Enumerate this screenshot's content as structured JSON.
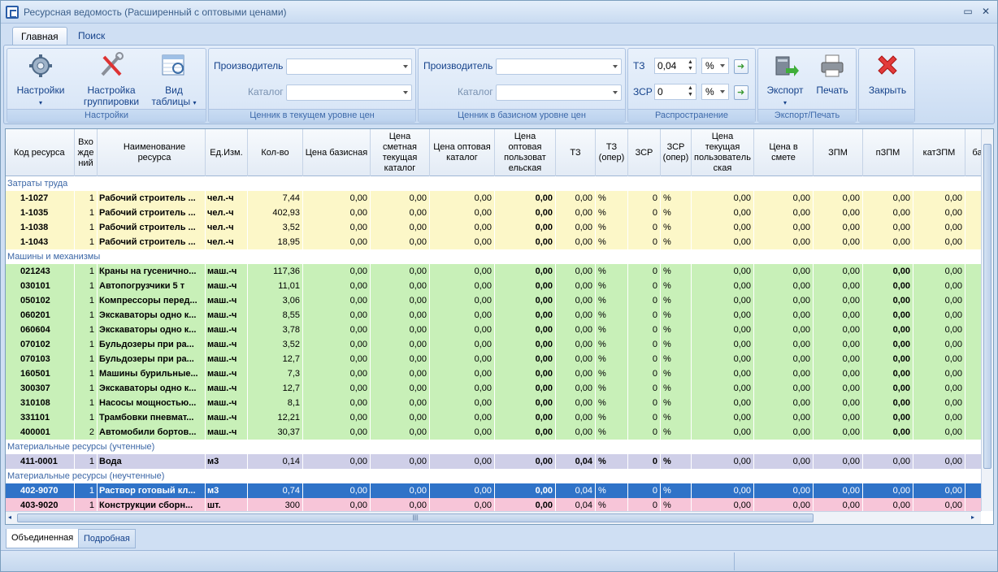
{
  "window": {
    "title": "Ресурсная ведомость (Расширенный с оптовыми ценами)",
    "min_icon": "minimize-icon",
    "close_icon": "close-icon"
  },
  "ribbon_tabs": [
    "Главная",
    "Поиск"
  ],
  "groups": {
    "settings": {
      "label": "Настройки",
      "btn_settings": "Настройки",
      "btn_grouping_1": "Настройка",
      "btn_grouping_2": "группировки",
      "btn_view_1": "Вид",
      "btn_view_2": "таблицы"
    },
    "current_price": {
      "label": "Ценник в текущем уровне цен",
      "maker": "Производитель",
      "catalog": "Каталог",
      "maker_value": "",
      "catalog_value": ""
    },
    "base_price": {
      "label": "Ценник в базисном уровне цен",
      "maker": "Производитель",
      "catalog": "Каталог",
      "maker_value": "",
      "catalog_value": ""
    },
    "spread": {
      "label": "Распространение",
      "tz_label": "ТЗ",
      "tz_value": "0,04",
      "tz_unit": "%",
      "zsr_label": "ЗСР",
      "zsr_value": "0",
      "zsr_unit": "%"
    },
    "export": {
      "label": "Экспорт/Печать",
      "btn_export": "Экспорт",
      "btn_print": "Печать"
    },
    "close": {
      "btn_close": "Закрыть"
    }
  },
  "columns": [
    "Код ресурса",
    "Вхо\nжде\nний",
    "Наименование ресурса",
    "Ед.Изм.",
    "Кол-во",
    "Цена базисная",
    "Цена\nсметная\nтекущая\nкаталог",
    "Цена оптовая\nкаталог",
    "Цена\nоптовая\nпользоват\nельская",
    "ТЗ",
    "ТЗ\n(опер)",
    "ЗСР",
    "ЗСР\n(опер)",
    "Цена\nтекущая\nпользоватeль\nская",
    "Цена в смете",
    "ЗПМ",
    "пЗПМ",
    "катЗПМ",
    "ба"
  ],
  "groups_rows": [
    {
      "title": "Затраты труда",
      "rows": [
        {
          "code": "1-1027",
          "n": "1",
          "name": "Рабочий строитель ...",
          "unit": "чел.-ч",
          "qty": "7,44",
          "style": "Y"
        },
        {
          "code": "1-1035",
          "n": "1",
          "name": "Рабочий строитель ...",
          "unit": "чел.-ч",
          "qty": "402,93",
          "style": "Y"
        },
        {
          "code": "1-1038",
          "n": "1",
          "name": "Рабочий строитель ...",
          "unit": "чел.-ч",
          "qty": "3,52",
          "style": "Y"
        },
        {
          "code": "1-1043",
          "n": "1",
          "name": "Рабочий строитель ...",
          "unit": "чел.-ч",
          "qty": "18,95",
          "style": "Y"
        }
      ]
    },
    {
      "title": "Машины и механизмы",
      "rows": [
        {
          "code": "021243",
          "n": "1",
          "name": "Краны на гусенично...",
          "unit": "маш.-ч",
          "qty": "117,36",
          "style": "G"
        },
        {
          "code": "030101",
          "n": "1",
          "name": "Автопогрузчики 5 т",
          "unit": "маш.-ч",
          "qty": "11,01",
          "style": "G"
        },
        {
          "code": "050102",
          "n": "1",
          "name": "Компрессоры перед...",
          "unit": "маш.-ч",
          "qty": "3,06",
          "style": "G"
        },
        {
          "code": "060201",
          "n": "1",
          "name": "Экскаваторы одно к...",
          "unit": "маш.-ч",
          "qty": "8,55",
          "style": "G"
        },
        {
          "code": "060604",
          "n": "1",
          "name": "Экскаваторы одно к...",
          "unit": "маш.-ч",
          "qty": "3,78",
          "style": "G"
        },
        {
          "code": "070102",
          "n": "1",
          "name": "Бульдозеры при ра...",
          "unit": "маш.-ч",
          "qty": "3,52",
          "style": "G"
        },
        {
          "code": "070103",
          "n": "1",
          "name": "Бульдозеры при ра...",
          "unit": "маш.-ч",
          "qty": "12,7",
          "style": "G"
        },
        {
          "code": "160501",
          "n": "1",
          "name": "Машины бурильные...",
          "unit": "маш.-ч",
          "qty": "7,3",
          "style": "G"
        },
        {
          "code": "300307",
          "n": "1",
          "name": "Экскаваторы одно к...",
          "unit": "маш.-ч",
          "qty": "12,7",
          "style": "G"
        },
        {
          "code": "310108",
          "n": "1",
          "name": "Насосы мощностью...",
          "unit": "маш.-ч",
          "qty": "8,1",
          "style": "G"
        },
        {
          "code": "331101",
          "n": "1",
          "name": "Трамбовки пневмат...",
          "unit": "маш.-ч",
          "qty": "12,21",
          "style": "G"
        },
        {
          "code": "400001",
          "n": "2",
          "name": "Автомобили бортов...",
          "unit": "маш.-ч",
          "qty": "30,37",
          "style": "G"
        }
      ]
    },
    {
      "title": "Материальные ресурсы (учтенные)",
      "rows": [
        {
          "code": "411-0001",
          "n": "1",
          "name": "Вода",
          "unit": "м3",
          "qty": "0,14",
          "style": "L"
        }
      ]
    },
    {
      "title": "Материальные ресурсы (неучтенные)",
      "rows": [
        {
          "code": "402-9070",
          "n": "1",
          "name": "Раствор готовый кл...",
          "unit": "м3",
          "qty": "0,74",
          "style": "Sel"
        },
        {
          "code": "403-9020",
          "n": "1",
          "name": "Конструкции сборн...",
          "unit": "шт.",
          "qty": "300",
          "style": "P"
        }
      ]
    }
  ],
  "values": {
    "zero": "0,00",
    "tz_zero": "0,00",
    "tz_val": "0,04",
    "zsr": "0",
    "pct": "%"
  },
  "bottom_tabs": [
    "Объединенная",
    "Подробная"
  ]
}
